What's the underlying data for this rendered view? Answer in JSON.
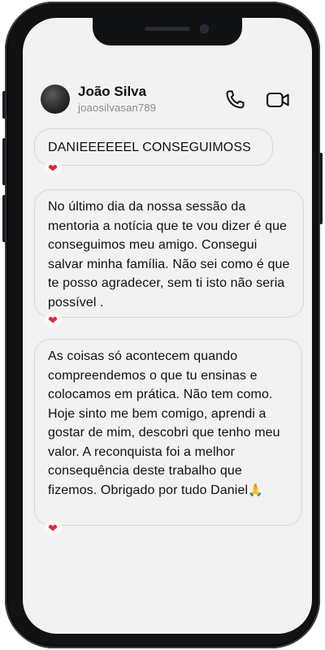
{
  "contact": {
    "name": "João Silva",
    "username": "joaosilvasan789"
  },
  "icons": {
    "call": "phone-icon",
    "video": "video-camera-icon",
    "reaction": "heart-icon",
    "emoji": "folded-hands-icon"
  },
  "colors": {
    "heart": "#e0243c",
    "bubble_border": "#d8d8d8",
    "screen_background": "#f2f2f2"
  },
  "messages": [
    {
      "text": "DANIEEEEEEL CONSEGUIMOSS",
      "reaction": "❤"
    },
    {
      "text": "No último dia da nossa sessão da mentoria a notícia que te vou dizer é que conseguimos meu amigo. Consegui salvar minha família. Não sei como é que te posso agradecer, sem ti isto não seria possível .",
      "reaction": "❤"
    },
    {
      "text": "As coisas só acontecem quando compreendemos o que tu ensinas e colocamos em prática. Não tem como. Hoje sinto me bem comigo, aprendi a gostar de mim, descobri que tenho meu valor. A reconquista foi a melhor consequência deste trabalho que fizemos. Obrigado por tudo Daniel",
      "emoji": "🙏",
      "reaction": "❤"
    }
  ]
}
